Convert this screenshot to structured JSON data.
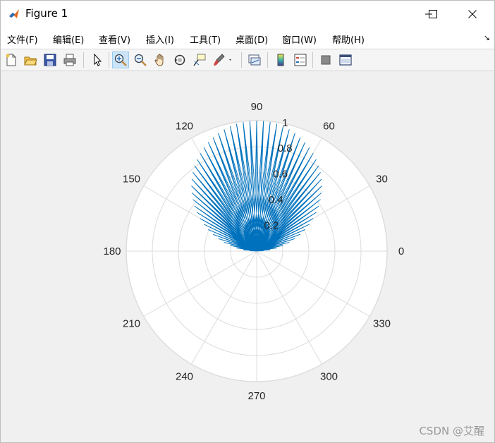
{
  "window": {
    "title": "Figure 1",
    "minimize_label": "—",
    "maximize_label": "☐",
    "close_label": "✕"
  },
  "menu": {
    "items": [
      {
        "label": "文件(F)"
      },
      {
        "label": "编辑(E)"
      },
      {
        "label": "查看(V)"
      },
      {
        "label": "插入(I)"
      },
      {
        "label": "工具(T)"
      },
      {
        "label": "桌面(D)"
      },
      {
        "label": "窗口(W)"
      },
      {
        "label": "帮助(H)"
      }
    ],
    "dock_arrow": "↘"
  },
  "toolbar": {
    "buttons": [
      {
        "icon": "new-figure-icon"
      },
      {
        "icon": "open-file-icon"
      },
      {
        "icon": "save-icon"
      },
      {
        "icon": "print-icon"
      },
      {
        "icon": "edit-plot-icon"
      },
      {
        "icon": "zoom-in-icon",
        "active": true
      },
      {
        "icon": "zoom-out-icon"
      },
      {
        "icon": "pan-icon"
      },
      {
        "icon": "rotate-3d-icon"
      },
      {
        "icon": "data-cursor-icon"
      },
      {
        "icon": "brush-icon"
      },
      {
        "icon": "link-plot-icon"
      },
      {
        "icon": "insert-colorbar-icon"
      },
      {
        "icon": "insert-legend-icon"
      },
      {
        "icon": "hide-plot-tools-icon"
      },
      {
        "icon": "show-plot-tools-icon"
      }
    ]
  },
  "chart_data": {
    "type": "line",
    "coordinate_system": "polar",
    "theta_unit": "degrees",
    "r_formula_description": "rose-like star trace: samples alternate between r = sin(theta) and r = 0",
    "theta_samples_deg": [
      0,
      3,
      6,
      9,
      12,
      15,
      18,
      21,
      24,
      27,
      30,
      33,
      36,
      39,
      42,
      45,
      48,
      51,
      54,
      57,
      60,
      63,
      66,
      69,
      72,
      75,
      78,
      81,
      84,
      87,
      90,
      93,
      96,
      99,
      102,
      105,
      108,
      111,
      114,
      117,
      120,
      123,
      126,
      129,
      132,
      135,
      138,
      141,
      144,
      147,
      150,
      153,
      156,
      159,
      162,
      165,
      168,
      171,
      174,
      177,
      180
    ],
    "r_envelope": "sin(theta)",
    "rlim": [
      0,
      1
    ],
    "r_ticks": [
      "0.2",
      "0.4",
      "0.6",
      "0.8",
      "1"
    ],
    "theta_ticks": [
      "0",
      "30",
      "60",
      "90",
      "120",
      "150",
      "180",
      "210",
      "240",
      "270",
      "300",
      "330"
    ],
    "grid": true,
    "line_color": "#0072bd",
    "grid_color": "#dcdcdc",
    "series": [
      {
        "values_note": "star pattern inside circle of diameter 1 above origin"
      }
    ]
  },
  "watermark": "CSDN @艾醒"
}
